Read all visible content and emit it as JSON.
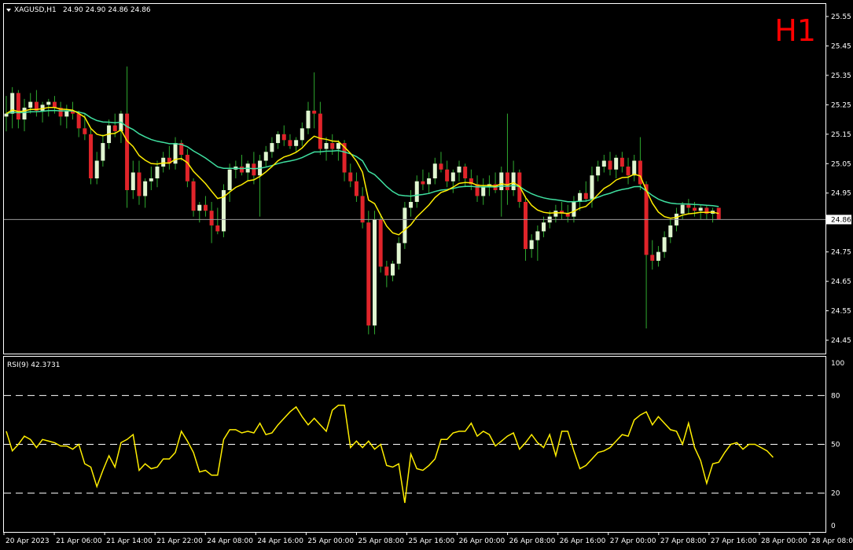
{
  "header": {
    "symbol_label": "XAGUSD,H1",
    "ohlc_label": "24.90 24.90 24.86 24.86",
    "timeframe_badge": "H1"
  },
  "rsi_panel": {
    "label": "RSI(9) 42.3731"
  },
  "colors": {
    "background": "#000000",
    "panel_border": "#ffffff",
    "bull_candle": "#e0f5d0",
    "bear_candle": "#e0242a",
    "wick": "#2faa2f",
    "ma_fast": "#ffee00",
    "ma_slow": "#3fe0a0",
    "rsi_line": "#ffee00",
    "axis_text": "#ffffff",
    "badge": "#ff0000"
  },
  "chart_data": [
    {
      "type": "candlestick",
      "symbol": "XAGUSD",
      "timeframe": "H1",
      "price_axis_ticks": [
        "25.55",
        "25.45",
        "25.35",
        "25.25",
        "25.15",
        "25.05",
        "24.95",
        "24.86",
        "24.75",
        "24.65",
        "24.55",
        "24.45"
      ],
      "ylim": [
        24.42,
        25.58
      ],
      "current_price": 24.86,
      "time_labels": [
        "20 Apr 2023",
        "21 Apr 06:00",
        "21 Apr 14:00",
        "21 Apr 22:00",
        "24 Apr 08:00",
        "24 Apr 16:00",
        "25 Apr 00:00",
        "25 Apr 08:00",
        "25 Apr 16:00",
        "26 Apr 00:00",
        "26 Apr 08:00",
        "26 Apr 16:00",
        "27 Apr 00:00",
        "27 Apr 08:00",
        "27 Apr 16:00",
        "28 Apr 00:00",
        "28 Apr 08:00"
      ],
      "candles": [
        [
          25.21,
          25.28,
          25.16,
          25.22
        ],
        [
          25.22,
          25.31,
          25.17,
          25.29
        ],
        [
          25.29,
          25.3,
          25.17,
          25.2
        ],
        [
          25.2,
          25.27,
          25.16,
          25.24
        ],
        [
          25.24,
          25.29,
          25.22,
          25.26
        ],
        [
          25.26,
          25.3,
          25.21,
          25.23
        ],
        [
          25.23,
          25.26,
          25.19,
          25.25
        ],
        [
          25.25,
          25.27,
          25.21,
          25.26
        ],
        [
          25.26,
          25.28,
          25.22,
          25.24
        ],
        [
          25.24,
          25.26,
          25.18,
          25.21
        ],
        [
          25.21,
          25.25,
          25.17,
          25.23
        ],
        [
          25.23,
          25.26,
          25.2,
          25.22
        ],
        [
          25.22,
          25.23,
          25.14,
          25.17
        ],
        [
          25.17,
          25.22,
          25.13,
          25.15
        ],
        [
          25.15,
          25.17,
          24.98,
          25.0
        ],
        [
          25.0,
          25.09,
          24.98,
          25.06
        ],
        [
          25.06,
          25.15,
          25.04,
          25.12
        ],
        [
          25.12,
          25.2,
          25.1,
          25.18
        ],
        [
          25.18,
          25.22,
          25.14,
          25.16
        ],
        [
          25.16,
          25.23,
          25.12,
          25.22
        ],
        [
          25.22,
          25.38,
          24.9,
          24.96
        ],
        [
          24.96,
          25.06,
          24.93,
          25.02
        ],
        [
          25.02,
          25.06,
          24.91,
          24.94
        ],
        [
          24.94,
          25.0,
          24.9,
          24.99
        ],
        [
          24.99,
          25.04,
          24.96,
          25.0
        ],
        [
          25.0,
          25.06,
          24.97,
          25.04
        ],
        [
          25.04,
          25.09,
          25.02,
          25.07
        ],
        [
          25.07,
          25.11,
          25.03,
          25.05
        ],
        [
          25.05,
          25.14,
          25.03,
          25.12
        ],
        [
          25.12,
          25.13,
          25.06,
          25.08
        ],
        [
          25.08,
          25.1,
          24.97,
          24.99
        ],
        [
          24.99,
          25.0,
          24.87,
          24.89
        ],
        [
          24.89,
          24.92,
          24.85,
          24.91
        ],
        [
          24.91,
          24.94,
          24.87,
          24.89
        ],
        [
          24.89,
          24.92,
          24.78,
          24.84
        ],
        [
          24.84,
          24.9,
          24.81,
          24.82
        ],
        [
          24.82,
          24.98,
          24.8,
          24.96
        ],
        [
          24.96,
          25.05,
          24.92,
          25.03
        ],
        [
          25.03,
          25.06,
          25.0,
          25.04
        ],
        [
          25.04,
          25.08,
          25.01,
          25.02
        ],
        [
          25.02,
          25.06,
          24.99,
          25.05
        ],
        [
          25.05,
          25.09,
          24.98,
          25.01
        ],
        [
          25.01,
          25.08,
          24.87,
          25.06
        ],
        [
          25.06,
          25.11,
          25.04,
          25.09
        ],
        [
          25.09,
          25.14,
          25.07,
          25.12
        ],
        [
          25.12,
          25.16,
          25.1,
          25.15
        ],
        [
          25.15,
          25.18,
          25.11,
          25.13
        ],
        [
          25.13,
          25.15,
          25.1,
          25.11
        ],
        [
          25.11,
          25.14,
          25.09,
          25.13
        ],
        [
          25.13,
          25.19,
          25.11,
          25.17
        ],
        [
          25.17,
          25.26,
          25.15,
          25.23
        ],
        [
          25.23,
          25.36,
          25.17,
          25.22
        ],
        [
          25.22,
          25.26,
          25.08,
          25.1
        ],
        [
          25.1,
          25.14,
          25.06,
          25.12
        ],
        [
          25.12,
          25.15,
          25.08,
          25.1
        ],
        [
          25.1,
          25.13,
          25.06,
          25.12
        ],
        [
          25.12,
          25.13,
          24.99,
          25.02
        ],
        [
          25.02,
          25.05,
          24.97,
          24.99
        ],
        [
          24.99,
          25.02,
          24.92,
          24.94
        ],
        [
          24.94,
          24.97,
          24.83,
          24.85
        ],
        [
          24.85,
          24.89,
          24.47,
          24.5
        ],
        [
          24.5,
          24.89,
          24.47,
          24.86
        ],
        [
          24.86,
          24.88,
          24.68,
          24.7
        ],
        [
          24.7,
          24.72,
          24.63,
          24.67
        ],
        [
          24.67,
          24.72,
          24.65,
          24.71
        ],
        [
          24.71,
          24.8,
          24.69,
          24.78
        ],
        [
          24.78,
          24.92,
          24.76,
          24.9
        ],
        [
          24.9,
          24.96,
          24.87,
          24.92
        ],
        [
          24.92,
          25.01,
          24.9,
          24.99
        ],
        [
          24.99,
          25.03,
          24.96,
          24.98
        ],
        [
          24.98,
          25.02,
          24.95,
          25.0
        ],
        [
          25.0,
          25.07,
          24.98,
          25.05
        ],
        [
          25.05,
          25.09,
          25.02,
          25.03
        ],
        [
          25.03,
          25.06,
          24.97,
          24.99
        ],
        [
          24.99,
          25.03,
          24.95,
          25.02
        ],
        [
          25.02,
          25.06,
          24.99,
          25.04
        ],
        [
          25.04,
          25.05,
          24.97,
          25.0
        ],
        [
          25.0,
          25.03,
          24.96,
          24.98
        ],
        [
          24.98,
          25.01,
          24.92,
          24.94
        ],
        [
          24.94,
          25.0,
          24.91,
          24.97
        ],
        [
          24.97,
          25.01,
          24.94,
          24.98
        ],
        [
          24.98,
          25.02,
          24.95,
          24.96
        ],
        [
          24.96,
          25.04,
          24.87,
          25.02
        ],
        [
          25.02,
          25.22,
          24.91,
          24.96
        ],
        [
          24.96,
          25.06,
          24.94,
          25.02
        ],
        [
          25.02,
          25.03,
          24.9,
          24.92
        ],
        [
          24.92,
          24.94,
          24.72,
          24.76
        ],
        [
          24.76,
          24.81,
          24.73,
          24.79
        ],
        [
          24.79,
          24.84,
          24.72,
          24.82
        ],
        [
          24.82,
          24.87,
          24.8,
          24.85
        ],
        [
          24.85,
          24.89,
          24.83,
          24.87
        ],
        [
          24.87,
          24.91,
          24.85,
          24.89
        ],
        [
          24.89,
          24.92,
          24.86,
          24.88
        ],
        [
          24.88,
          24.91,
          24.85,
          24.87
        ],
        [
          24.87,
          24.94,
          24.85,
          24.92
        ],
        [
          24.92,
          24.96,
          24.89,
          24.95
        ],
        [
          24.95,
          24.99,
          24.92,
          24.93
        ],
        [
          24.93,
          25.04,
          24.9,
          25.01
        ],
        [
          25.01,
          25.06,
          24.99,
          25.04
        ],
        [
          25.04,
          25.08,
          25.02,
          25.06
        ],
        [
          25.06,
          25.09,
          25.01,
          25.03
        ],
        [
          25.03,
          25.08,
          25.0,
          25.07
        ],
        [
          25.07,
          25.09,
          25.02,
          25.04
        ],
        [
          25.04,
          25.07,
          24.98,
          25.01
        ],
        [
          25.01,
          25.08,
          24.99,
          25.06
        ],
        [
          25.06,
          25.14,
          24.96,
          24.98
        ],
        [
          24.98,
          24.99,
          24.49,
          24.74
        ],
        [
          24.74,
          24.79,
          24.69,
          24.72
        ],
        [
          24.72,
          24.77,
          24.7,
          24.75
        ],
        [
          24.75,
          24.82,
          24.73,
          24.8
        ],
        [
          24.8,
          24.86,
          24.78,
          24.84
        ],
        [
          24.84,
          24.9,
          24.82,
          24.88
        ],
        [
          24.88,
          24.92,
          24.86,
          24.91
        ],
        [
          24.91,
          24.93,
          24.88,
          24.9
        ],
        [
          24.9,
          24.92,
          24.87,
          24.89
        ],
        [
          24.89,
          24.91,
          24.86,
          24.9
        ],
        [
          24.9,
          24.91,
          24.86,
          24.88
        ],
        [
          24.88,
          24.9,
          24.85,
          24.89
        ],
        [
          24.9,
          24.9,
          24.86,
          24.86
        ]
      ]
    },
    {
      "type": "line",
      "name": "RSI(9)",
      "ylim": [
        0,
        100
      ],
      "y_ticks": [
        "100",
        "80",
        "50",
        "20",
        "0"
      ],
      "levels": [
        80,
        50,
        20
      ],
      "last_value": 42.3731,
      "values": [
        58,
        46,
        50,
        55,
        53,
        48,
        53,
        52,
        51,
        49,
        49,
        47,
        50,
        38,
        36,
        24,
        34,
        43,
        36,
        51,
        53,
        56,
        34,
        38,
        35,
        36,
        41,
        41,
        45,
        58,
        52,
        45,
        33,
        34,
        31,
        31,
        53,
        59,
        59,
        57,
        58,
        57,
        63,
        56,
        57,
        62,
        66,
        70,
        73,
        67,
        62,
        66,
        62,
        58,
        71,
        74,
        74,
        48,
        52,
        48,
        52,
        47,
        50,
        37,
        36,
        38,
        14,
        44,
        35,
        34,
        37,
        41,
        53,
        53,
        57,
        58,
        58,
        63,
        55,
        58,
        56,
        49,
        52,
        55,
        57,
        47,
        51,
        56,
        51,
        48,
        56,
        43,
        58,
        58,
        46,
        35,
        37,
        41,
        45,
        46,
        48,
        52,
        56,
        55,
        65,
        68,
        70,
        62,
        67,
        63,
        59,
        58,
        50,
        63,
        48,
        40,
        26,
        38,
        39,
        45,
        50,
        51,
        47,
        50,
        50,
        48,
        46,
        42
      ]
    }
  ]
}
